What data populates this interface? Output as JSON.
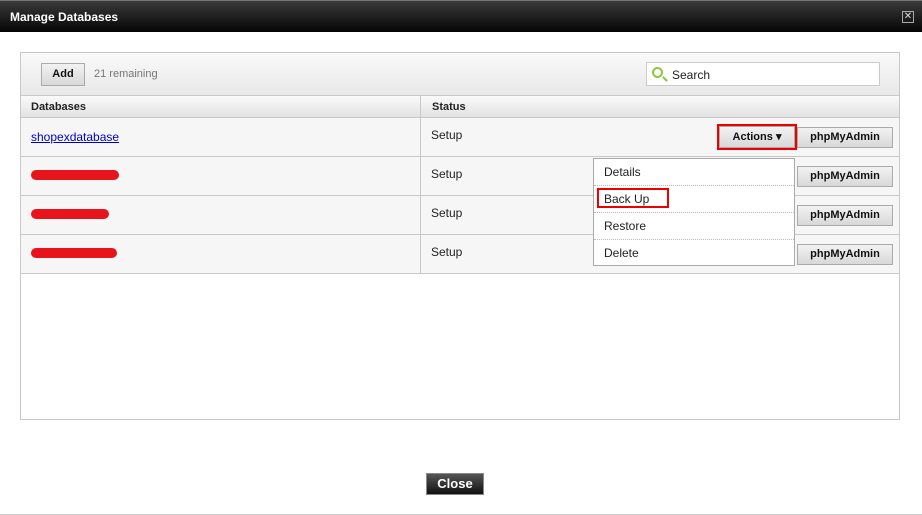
{
  "dialog": {
    "title": "Manage Databases",
    "close_label": "Close"
  },
  "toolbar": {
    "add_label": "Add",
    "remaining": "21 remaining",
    "search_placeholder": "Search"
  },
  "table": {
    "columns": [
      "Databases",
      "Status"
    ],
    "rows": [
      {
        "name": "shopexdatabase",
        "status": "Setup",
        "redacted": false
      },
      {
        "name": "",
        "status": "Setup",
        "redacted": true
      },
      {
        "name": "",
        "status": "Setup",
        "redacted": true
      },
      {
        "name": "",
        "status": "Setup",
        "redacted": true
      }
    ],
    "actions_label": "Actions",
    "phpmyadmin_label": "phpMyAdmin"
  },
  "actions_menu": {
    "items": [
      "Details",
      "Back Up",
      "Restore",
      "Delete"
    ],
    "highlighted": "Back Up"
  },
  "colors": {
    "highlight": "#e00000",
    "redaction": "#e8141c",
    "link": "#0000cc",
    "search_icon": "#8dc63f"
  }
}
